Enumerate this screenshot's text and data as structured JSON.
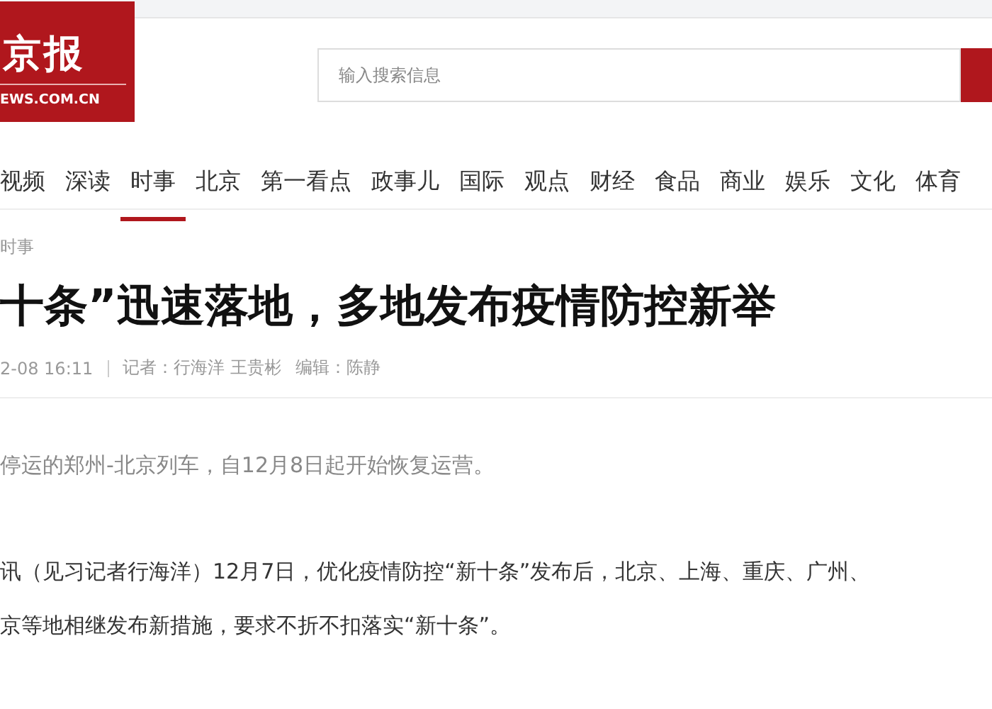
{
  "header": {
    "logo_title": "京报",
    "logo_domain": "EWS.COM.CN",
    "search": {
      "placeholder": "输入搜索信息"
    }
  },
  "nav": [
    {
      "label": "视频",
      "selected": false
    },
    {
      "label": "深读",
      "selected": false
    },
    {
      "label": "时事",
      "selected": true
    },
    {
      "label": "北京",
      "selected": false
    },
    {
      "label": "第一看点",
      "selected": false
    },
    {
      "label": "政事儿",
      "selected": false
    },
    {
      "label": "国际",
      "selected": false
    },
    {
      "label": "观点",
      "selected": false
    },
    {
      "label": "财经",
      "selected": false
    },
    {
      "label": "食品",
      "selected": false
    },
    {
      "label": "商业",
      "selected": false
    },
    {
      "label": "娱乐",
      "selected": false
    },
    {
      "label": "文化",
      "selected": false
    },
    {
      "label": "体育",
      "selected": false
    }
  ],
  "article": {
    "breadcrumb": "时事",
    "title": "十条”迅速落地，多地发布疫情防控新举",
    "time": "2-08 16:11",
    "reporters": "记者：行海洋 王贵彬",
    "editor": "编辑：陈静",
    "lead": "停运的郑州-北京列车，自12月8日起开始恢复运营。",
    "paragraphs": [
      "讯（见习记者行海洋）12月7日，优化疫情防控“新十条”发布后，北京、上海、重庆、广州、",
      "京等地相继发布新措施，要求不折不扣落实“新十条”。"
    ]
  }
}
